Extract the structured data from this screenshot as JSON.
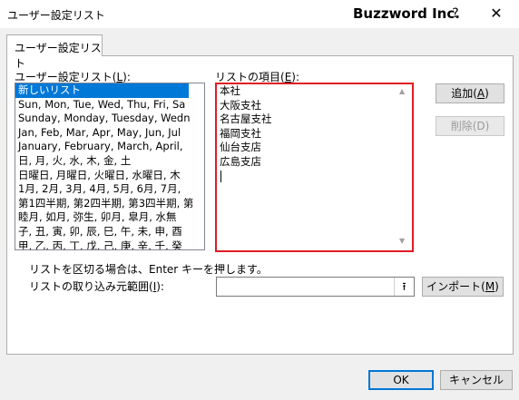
{
  "window": {
    "title": "ユーザー設定リスト",
    "brand": "Buzzword Inc.",
    "help_icon": "?",
    "close_icon": "✕"
  },
  "tab": {
    "label": "ユーザー設定リスト"
  },
  "custom_lists": {
    "label_prefix": "ユーザー設定リスト(",
    "label_key": "L",
    "label_suffix": "):",
    "items": [
      "新しいリスト",
      "Sun, Mon, Tue, Wed, Thu, Fri, Sa",
      "Sunday, Monday, Tuesday, Wedn",
      "Jan, Feb, Mar, Apr, May, Jun, Jul",
      "January, February, March, April,",
      "日, 月, 火, 水, 木, 金, 土",
      "日曜日, 月曜日, 火曜日, 水曜日, 木",
      "1月, 2月, 3月, 4月, 5月, 6月, 7月,",
      "第1四半期, 第2四半期, 第3四半期, 第",
      "睦月, 如月, 弥生, 卯月, 皐月, 水無",
      "子, 丑, 寅, 卯, 辰, 巳, 午, 未, 申, 酉",
      "甲, 乙, 丙, 丁, 戊, 己, 庚, 辛, 壬, 癸"
    ]
  },
  "list_entries": {
    "label_prefix": "リストの項目(",
    "label_key": "E",
    "label_suffix": "):",
    "lines": [
      "本社",
      "大阪支社",
      "名古屋支社",
      "福岡支社",
      "仙台支店",
      "広島支店"
    ]
  },
  "buttons": {
    "add_prefix": "追加(",
    "add_key": "A",
    "add_suffix": ")",
    "delete_label": "削除(D)",
    "import_prefix": "インポート(",
    "import_key": "M",
    "import_suffix": ")",
    "ok": "OK",
    "cancel": "キャンセル"
  },
  "hint": "リストを区切る場合は、Enter キーを押します。",
  "import_range": {
    "label_prefix": "リストの取り込み元範囲(",
    "label_key": "I",
    "label_suffix": "):",
    "value": "",
    "collapse_icon": "⭱"
  }
}
